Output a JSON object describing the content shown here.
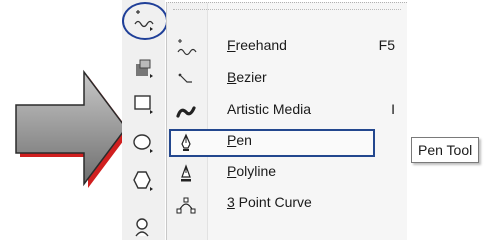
{
  "menu": {
    "items": [
      {
        "id": "freehand",
        "mnemonic": "F",
        "label_rest": "reehand",
        "shortcut": "F5",
        "icon": "freehand-icon"
      },
      {
        "id": "bezier",
        "mnemonic": "B",
        "label_rest": "ezier",
        "shortcut": "",
        "icon": "bezier-icon"
      },
      {
        "id": "artistic-media",
        "mnemonic": "",
        "label_rest": "Artistic Media",
        "shortcut": "I",
        "icon": "artistic-media-icon"
      },
      {
        "id": "pen",
        "mnemonic": "P",
        "label_rest": "en",
        "shortcut": "",
        "icon": "pen-icon",
        "active": true
      },
      {
        "id": "polyline",
        "mnemonic": "P",
        "label_rest": "olyline",
        "shortcut": "",
        "icon": "polyline-icon"
      },
      {
        "id": "3-point-curve",
        "mnemonic": "3",
        "label_rest": " Point Curve",
        "shortcut": "",
        "icon": "3-point-curve-icon"
      }
    ]
  },
  "tooltip": {
    "text": "Pen Tool"
  },
  "toolbox": {
    "tools": [
      "curve-tool-icon",
      "smart-fill-icon",
      "rectangle-icon",
      "ellipse-icon",
      "polygon-icon",
      "basic-shapes-icon"
    ]
  },
  "colors": {
    "highlight": "#23478e",
    "arrow_fill": "#8e8e8e",
    "arrow_shadow": "#d01f1f"
  }
}
